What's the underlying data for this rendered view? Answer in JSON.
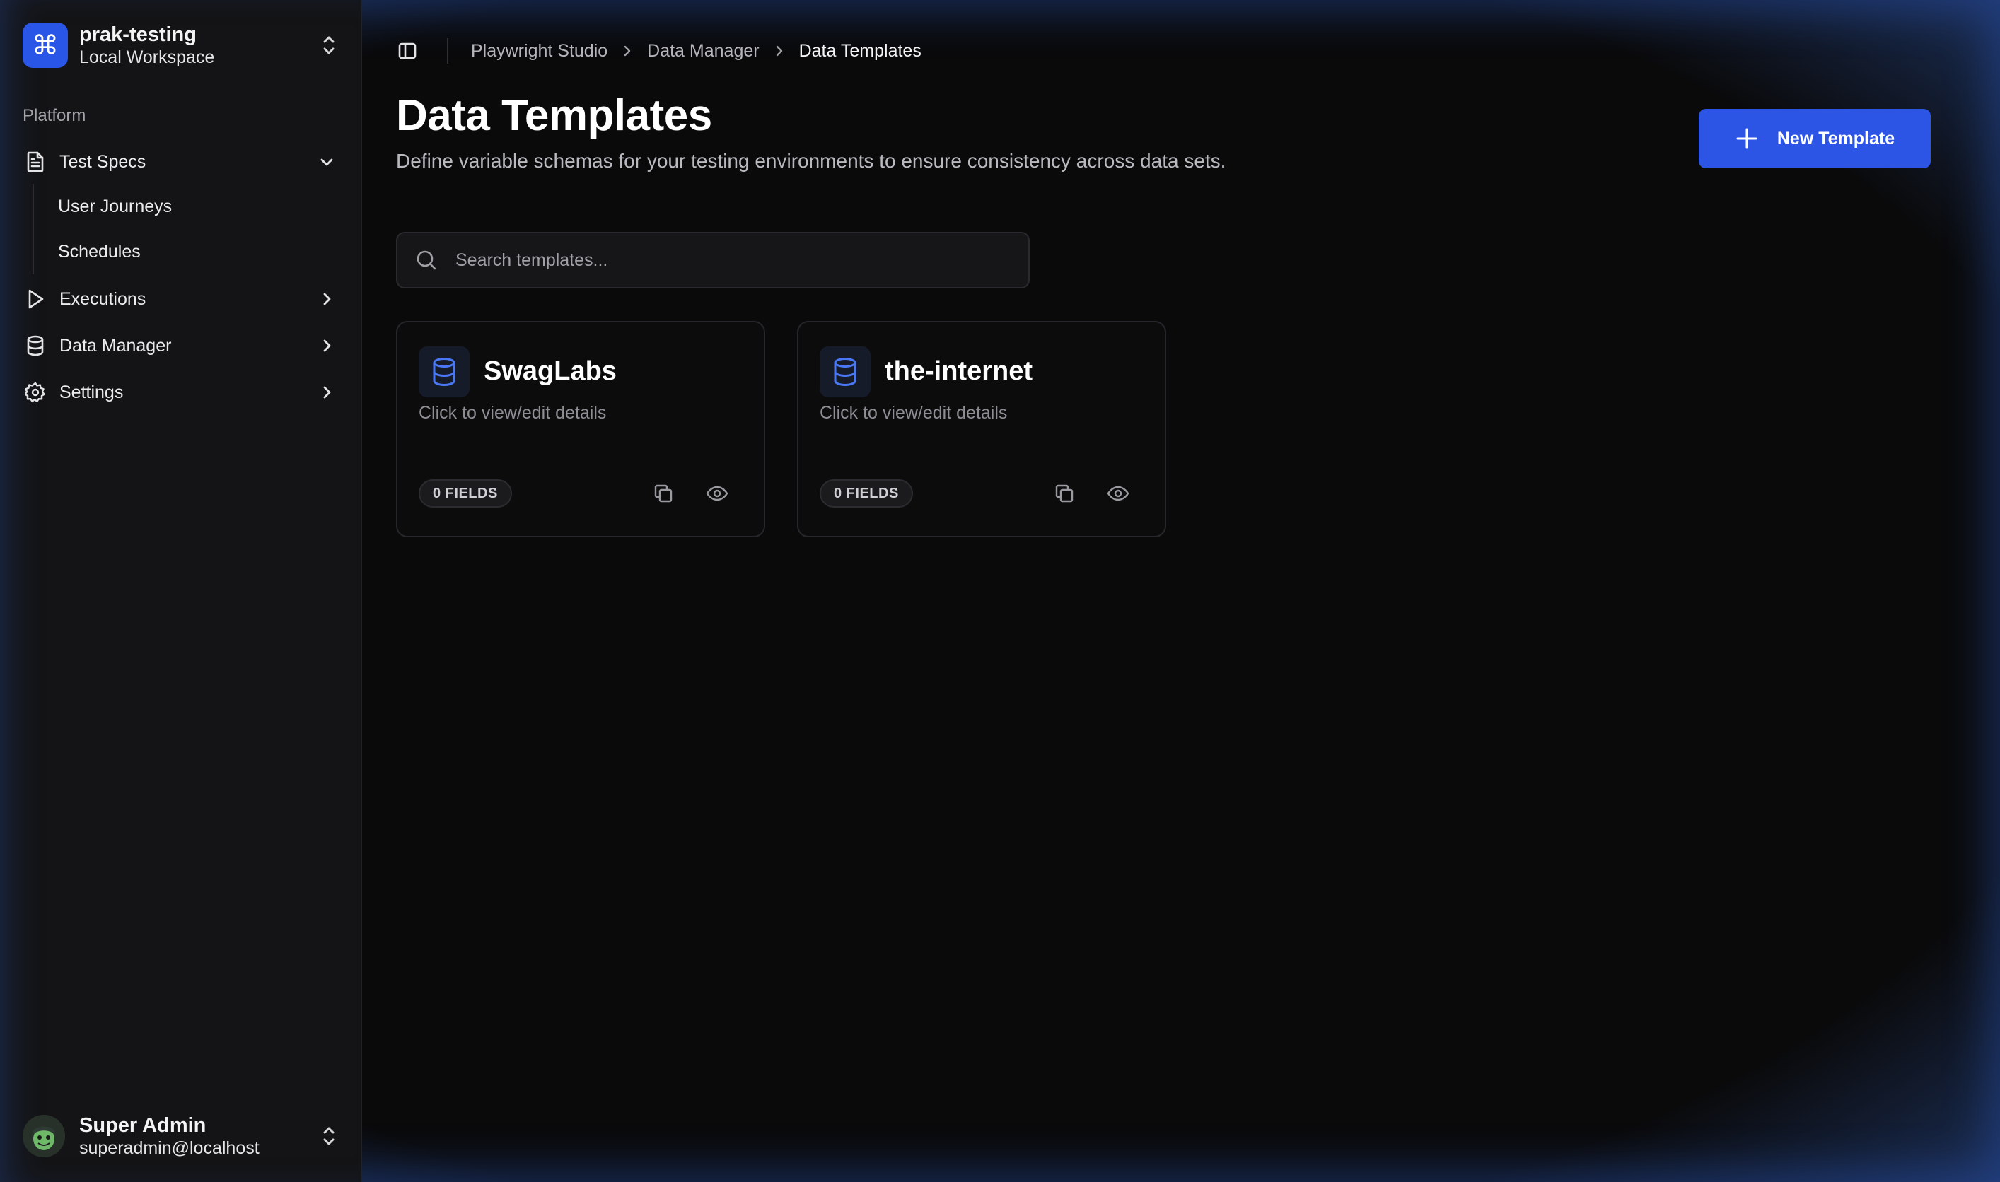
{
  "workspace": {
    "name": "prak-testing",
    "subtitle": "Local Workspace",
    "logo_glyph": "⌘",
    "accent": "#2a56e8"
  },
  "sidebar": {
    "section_label": "Platform",
    "items": [
      {
        "label": "Test Specs",
        "icon": "file-text-icon",
        "expanded": true,
        "children": [
          {
            "label": "User Journeys"
          },
          {
            "label": "Schedules"
          }
        ]
      },
      {
        "label": "Executions",
        "icon": "play-icon"
      },
      {
        "label": "Data Manager",
        "icon": "database-icon"
      },
      {
        "label": "Settings",
        "icon": "gear-icon"
      }
    ]
  },
  "user": {
    "name": "Super Admin",
    "email": "superadmin@localhost"
  },
  "breadcrumb": [
    "Playwright Studio",
    "Data Manager",
    "Data Templates"
  ],
  "page": {
    "title": "Data Templates",
    "description": "Define variable schemas for your testing environments to ensure consistency across data sets.",
    "new_button_label": "New Template"
  },
  "search": {
    "placeholder": "Search templates..."
  },
  "templates": [
    {
      "name": "SwagLabs",
      "subtitle": "Click to view/edit details",
      "fields_badge": "0 FIELDS"
    },
    {
      "name": "the-internet",
      "subtitle": "Click to view/edit details",
      "fields_badge": "0 FIELDS"
    }
  ]
}
